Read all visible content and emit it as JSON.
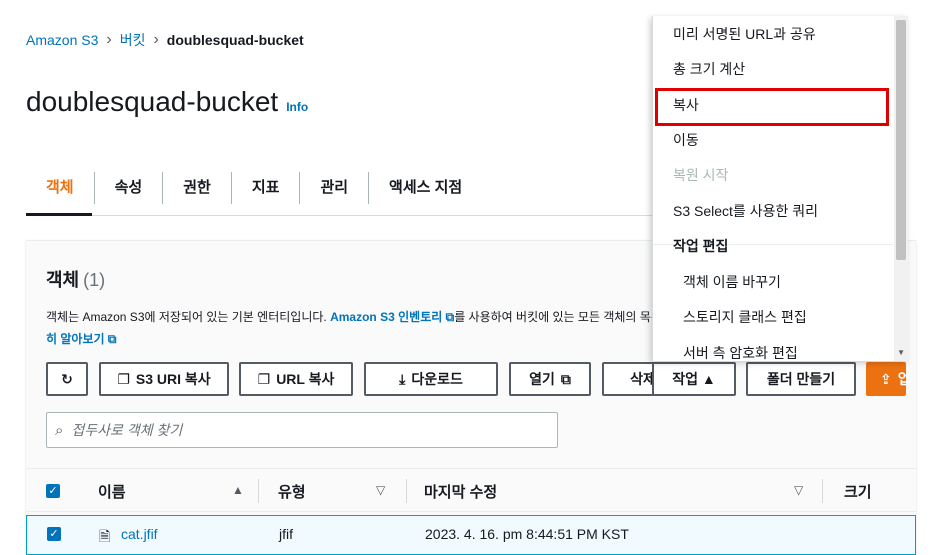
{
  "breadcrumb": {
    "root": "Amazon S3",
    "buckets": "버킷",
    "current": "doublesquad-bucket"
  },
  "page": {
    "title": "doublesquad-bucket",
    "info": "Info"
  },
  "tabs": [
    "객체",
    "속성",
    "권한",
    "지표",
    "관리",
    "액세스 지점"
  ],
  "objects": {
    "heading": "객체",
    "count": "(1)",
    "desc_part1": "객체는 Amazon S3에 저장되어 있는 기본 엔터티입니다. ",
    "desc_link": "Amazon S3 인벤토리",
    "desc_part2": "를 사용하여 버킷에 있는 모든 객체의 목록",
    "desc_line2": "히 알아보기"
  },
  "toolbar": {
    "copy_s3_uri": "S3 URI 복사",
    "copy_url": "URL 복사",
    "download": "다운로드",
    "open": "열기",
    "delete": "삭제",
    "actions": "작업 ▲",
    "create_folder": "폴더 만들기",
    "upload_fragment": "업"
  },
  "search": {
    "placeholder": "접두사로 객체 찾기"
  },
  "table": {
    "headers": {
      "name": "이름",
      "type": "유형",
      "last_modified": "마지막 수정",
      "size": "크기"
    },
    "rows": [
      {
        "name": "cat.jfif",
        "type": "jfif",
        "last_modified": "2023. 4. 16. pm 8:44:51 PM KST"
      }
    ]
  },
  "actions_menu": {
    "items": [
      "미리 서명된 URL과 공유",
      "총 크기 계산",
      "복사",
      "이동",
      "복원 시작",
      "S3 Select를 사용한 쿼리"
    ],
    "group_label": "작업 편집",
    "sub_items": [
      "객체 이름 바꾸기",
      "스토리지 클래스 편집",
      "서버 측 암호화 편집"
    ]
  },
  "colors": {
    "accent": "#ec7211",
    "link": "#0073bb",
    "highlight": "#e00000"
  }
}
